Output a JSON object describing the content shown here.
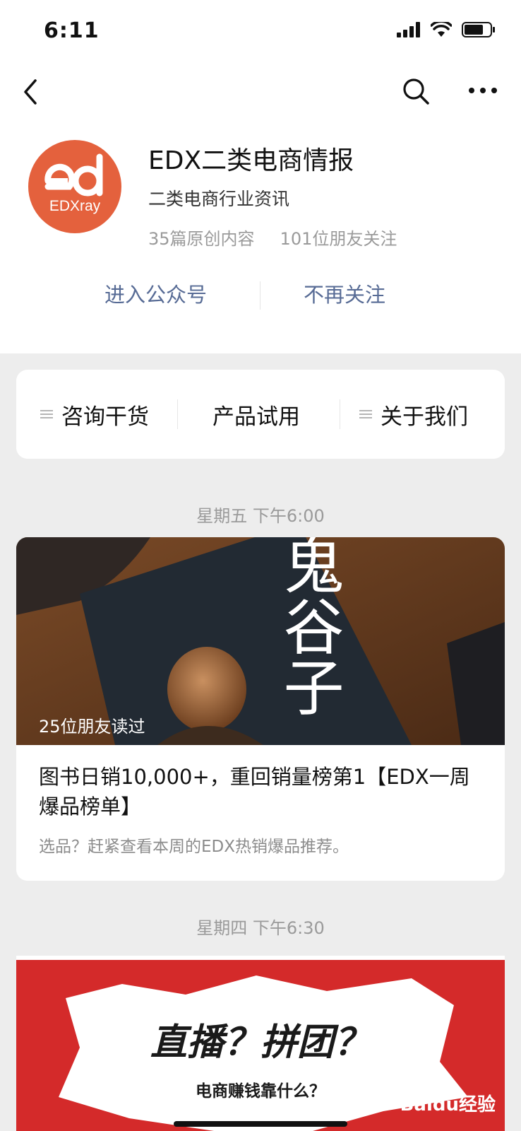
{
  "status": {
    "time": "6:11"
  },
  "nav": {
    "back_icon": "chevron-left-icon",
    "search_icon": "search-icon",
    "more_icon": "more-dots-icon"
  },
  "account": {
    "avatar_text": "EDXray",
    "name": "EDX二类电商情报",
    "description": "二类电商行业资讯",
    "original_count": "35篇原创内容",
    "followers": "101位朋友关注",
    "enter_label": "进入公众号",
    "unfollow_label": "不再关注"
  },
  "menu": {
    "items": [
      {
        "label": "咨询干货",
        "has_submenu": true
      },
      {
        "label": "产品试用",
        "has_submenu": false
      },
      {
        "label": "关于我们",
        "has_submenu": true
      }
    ]
  },
  "feed": {
    "groups": [
      {
        "date": "星期五 下午6:00",
        "article": {
          "read_count": "25位朋友读过",
          "title": "图书日销10,000+，重回销量榜第1【EDX一周爆品榜单】",
          "digest": "选品？赶紧查看本周的EDX热销爆品推荐。",
          "cover_text": "鬼谷子"
        }
      },
      {
        "date": "星期四 下午6:30",
        "article": {
          "cover_title": "直播？拼团？",
          "cover_subtitle": "电商赚钱靠什么？"
        }
      }
    ]
  },
  "watermark": "Baidu经验",
  "colors": {
    "link": "#576b95",
    "avatar": "#e4613d",
    "background": "#ededed"
  }
}
